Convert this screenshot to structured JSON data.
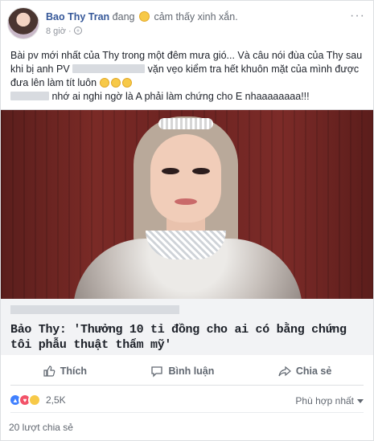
{
  "post": {
    "author": "Bao Thy Tran",
    "feeling_prefix": "đang",
    "feeling_text": "cảm thấy xinh xắn.",
    "timestamp": "8 giờ",
    "more_label": "···",
    "text_line1": "Bài pv mới nhất của Thy trong một đêm mưa gió... Và câu nói đùa của Thy sau",
    "text_line2_prefix": "khi bị anh PV",
    "text_line2_suffix": "vặn vẹo kiểm tra hết khuôn mặt của mình được",
    "text_line3": "đưa lên làm tít luôn",
    "text_line4": "nhớ ai nghi ngờ là A phải làm chứng cho E nhaaaaaaaa!!!"
  },
  "link_preview": {
    "title": "Bảo Thy: 'Thưởng 10 tỉ đồng cho ai có bằng chứng tôi phẫu thuật thẩm mỹ'"
  },
  "actions": {
    "like": "Thích",
    "comment": "Bình luận",
    "share": "Chia sẻ"
  },
  "stats": {
    "reaction_count": "2,5K",
    "sort_label": "Phù hợp nhất",
    "shares": "20 lượt chia sẻ"
  },
  "colors": {
    "link_blue": "#365899",
    "muted": "#616770",
    "like_blue": "#4080ff"
  }
}
